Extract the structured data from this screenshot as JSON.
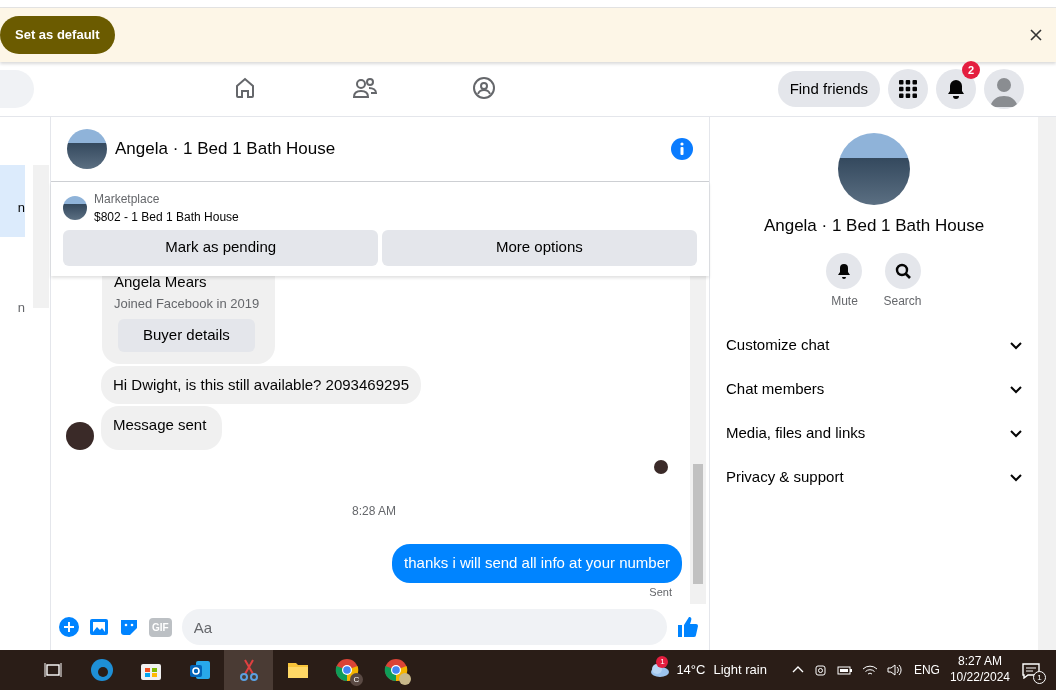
{
  "banner": {
    "button": "Set as default"
  },
  "topnav": {
    "find_friends": "Find friends",
    "notification_count": "2"
  },
  "sidebar": {
    "items": [
      {
        "text": "n",
        "selected": true
      },
      {
        "text": "n",
        "selected": false
      }
    ]
  },
  "chat": {
    "title": "Angela · 1 Bed 1 Bath House",
    "listing": {
      "source": "Marketplace",
      "title": "$802 - 1 Bed 1 Bath House"
    },
    "actions": [
      "Mark as pending",
      "More options"
    ],
    "messages": [
      {
        "kind": "buyer_card",
        "name": "Angela Mears",
        "subtitle": "Joined Facebook in 2019",
        "button": "Buyer details"
      },
      {
        "kind": "incoming",
        "text": "Hi Dwight, is this still available? 2093469295",
        "avatar": false
      },
      {
        "kind": "incoming",
        "text": "Message sent",
        "avatar": true
      },
      {
        "kind": "seen"
      },
      {
        "kind": "time",
        "text": "8:28 AM"
      },
      {
        "kind": "outgoing",
        "text": "thanks i will send all info at your number",
        "status": "Sent"
      }
    ],
    "composer": {
      "gif_label": "GIF",
      "placeholder": "Aa"
    }
  },
  "details": {
    "title": "Angela · 1 Bed 1 Bath House",
    "actions": [
      {
        "kind": "mute",
        "label": "Mute"
      },
      {
        "kind": "search",
        "label": "Search"
      }
    ],
    "sections": [
      {
        "label": "Customize chat",
        "expanded": false
      },
      {
        "label": "Chat members",
        "expanded": false
      },
      {
        "label": "Media, files and links",
        "expanded": false
      },
      {
        "label": "Privacy & support",
        "expanded": false
      }
    ]
  },
  "taskbar": {
    "chrome_badge": "C",
    "weather_badge": "1",
    "temperature": "14°C",
    "weather": "Light rain",
    "language": "ENG",
    "time": "8:27 AM",
    "date": "10/22/2024",
    "notification_count": "1"
  }
}
